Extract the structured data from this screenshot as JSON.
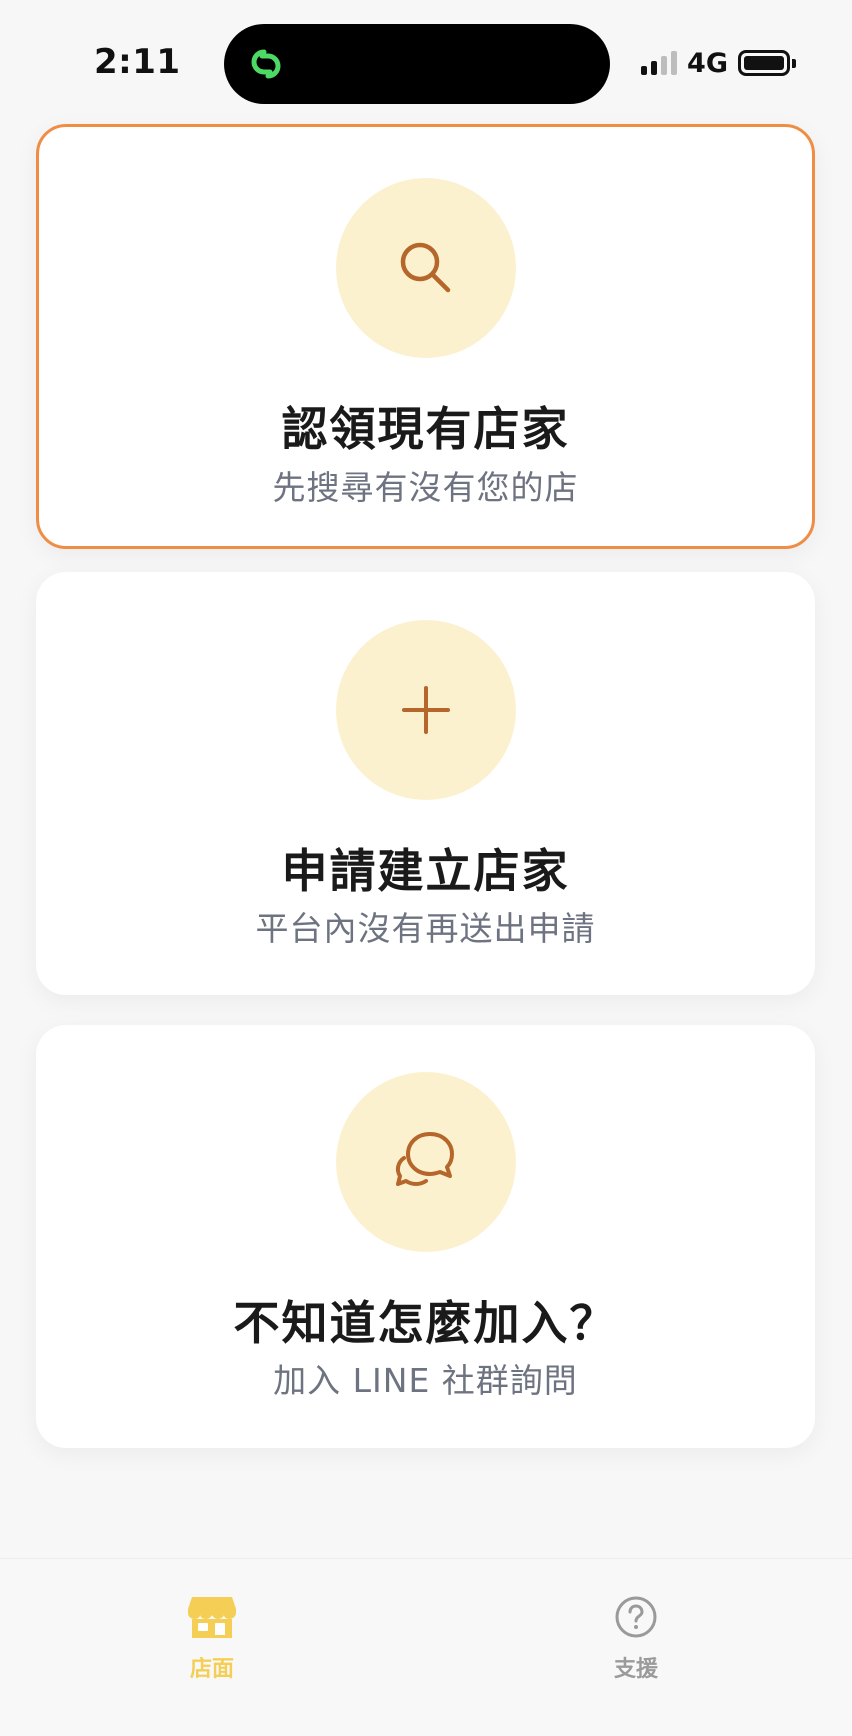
{
  "status_bar": {
    "time": "2:11",
    "network": "4G"
  },
  "cards": [
    {
      "icon": "search-icon",
      "title": "認領現有店家",
      "subtitle": "先搜尋有沒有您的店",
      "selected": true
    },
    {
      "icon": "plus-icon",
      "title": "申請建立店家",
      "subtitle": "平台內沒有再送出申請",
      "selected": false
    },
    {
      "icon": "chat-bubbles-icon",
      "title": "不知道怎麼加入？",
      "subtitle": "加入 LINE 社群詢問",
      "selected": false
    }
  ],
  "tab_bar": {
    "items": [
      {
        "label": "店面",
        "icon": "storefront-icon",
        "active": true
      },
      {
        "label": "支援",
        "icon": "help-circle-icon",
        "active": false
      }
    ]
  },
  "colors": {
    "accent_border": "#ef8d45",
    "icon_circle": "#fcf1cf",
    "icon_stroke": "#b5662a",
    "tab_active": "#f5cf55",
    "tab_inactive": "#9a9a9a",
    "island_icon": "#4cd964"
  }
}
